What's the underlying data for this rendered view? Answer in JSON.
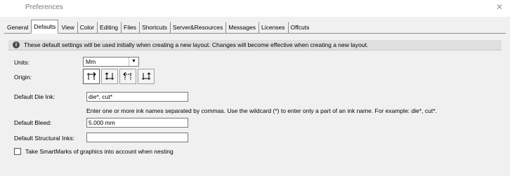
{
  "window": {
    "title": "Preferences",
    "close_glyph": "✕"
  },
  "tabs": [
    {
      "label": "General",
      "active": false
    },
    {
      "label": "Defaults",
      "active": true
    },
    {
      "label": "View",
      "active": false
    },
    {
      "label": "Color",
      "active": false
    },
    {
      "label": "Editing",
      "active": false
    },
    {
      "label": "Files",
      "active": false
    },
    {
      "label": "Shortcuts",
      "active": false
    },
    {
      "label": "Server&Resources",
      "active": false
    },
    {
      "label": "Messages",
      "active": false
    },
    {
      "label": "Licenses",
      "active": false
    },
    {
      "label": "Offcuts",
      "active": false
    }
  ],
  "info": {
    "icon": "info-icon",
    "text": "These default settings will be used initially when creating a new layout. Changes will become effective when creating a new layout."
  },
  "units": {
    "label": "Units:",
    "value": "Mm",
    "icon": "chevron-down-icon"
  },
  "origin": {
    "label": "Origin:",
    "buttons": [
      {
        "icon": "origin-top-left-icon",
        "selected": true
      },
      {
        "icon": "origin-bottom-left-icon",
        "selected": false
      },
      {
        "icon": "origin-top-right-icon",
        "selected": false
      },
      {
        "icon": "origin-bottom-right-icon",
        "selected": false
      }
    ]
  },
  "die_ink": {
    "label": "Default Die Ink:",
    "value": "die*, cut*",
    "help": "Enter one or more ink names separated by commas. Use the wildcard (*) to enter only a part of an ink name. For example: die*, cut*."
  },
  "bleed": {
    "label": "Default Bleed:",
    "value": "5.000 mm"
  },
  "structural_inks": {
    "label": "Default Structural Inks:",
    "value": ""
  },
  "smartmarks": {
    "label": "Take SmartMarks of graphics into account when nesting",
    "checked": false
  }
}
